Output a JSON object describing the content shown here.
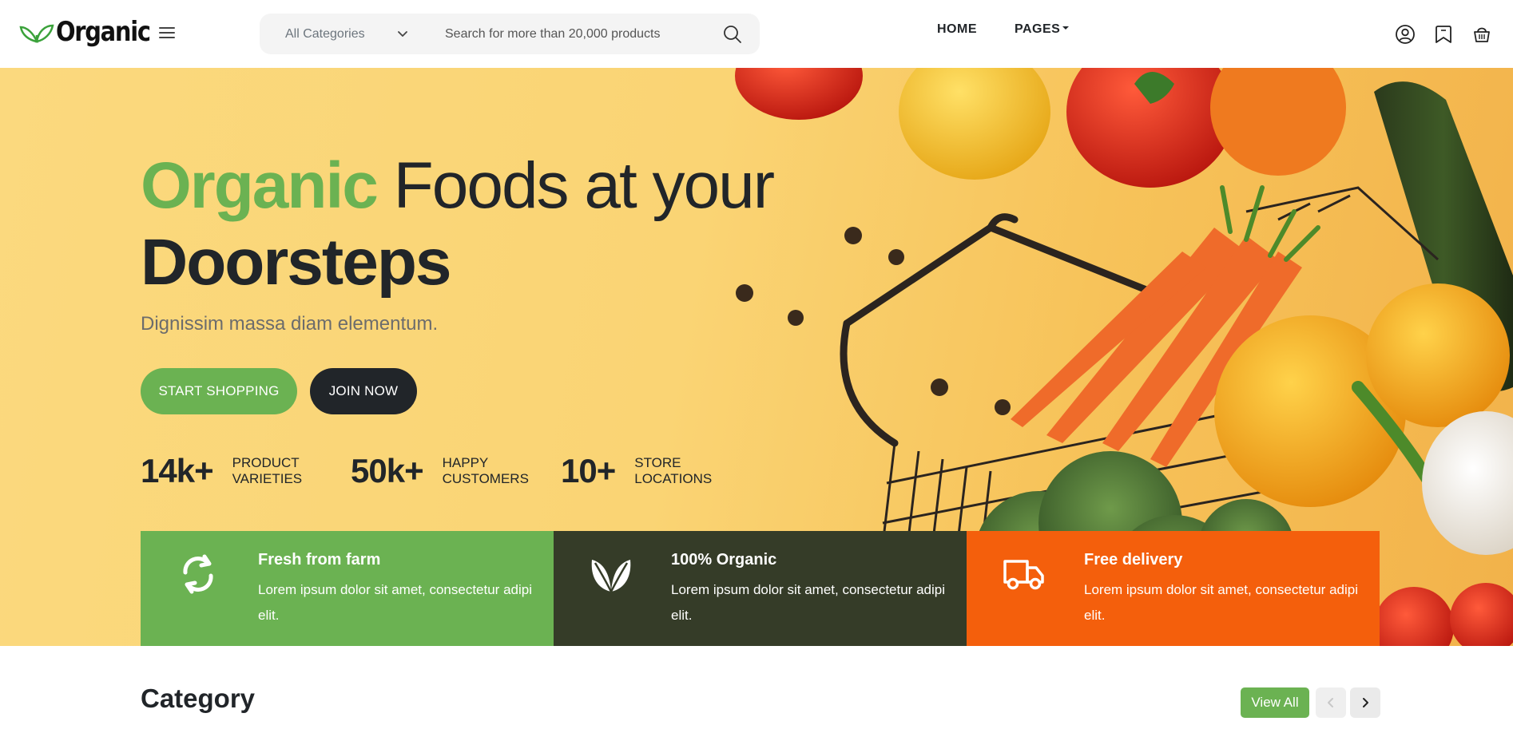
{
  "header": {
    "brand": "Organic",
    "category_select": "All Categories",
    "search_placeholder": "Search for more than 20,000 products",
    "nav": {
      "home": "HOME",
      "pages": "PAGES"
    }
  },
  "hero": {
    "title_green": "Organic",
    "title_rest": " Foods at your",
    "title_bold": "Doorsteps",
    "subtitle": "Dignissim massa diam elementum.",
    "btn_shop": "START SHOPPING",
    "btn_join": "JOIN NOW",
    "stats": [
      {
        "value": "14k+",
        "label": "PRODUCT\nVARIETIES"
      },
      {
        "value": "50k+",
        "label": "HAPPY\nCUSTOMERS"
      },
      {
        "value": "10+",
        "label": "STORE\nLOCATIONS"
      }
    ]
  },
  "features": [
    {
      "icon": "refresh-icon",
      "title": "Fresh from farm",
      "text": "Lorem ipsum dolor sit amet, consectetur adipi elit.",
      "color": "#6bb252"
    },
    {
      "icon": "leaf-icon",
      "title": "100% Organic",
      "text": "Lorem ipsum dolor sit amet, consectetur adipi elit.",
      "color": "#353c28"
    },
    {
      "icon": "truck-icon",
      "title": "Free delivery",
      "text": "Lorem ipsum dolor sit amet, consectetur adipi elit.",
      "color": "#f45f0c"
    }
  ],
  "category": {
    "title": "Category",
    "view_all": "View All"
  },
  "colors": {
    "accent_green": "#6bb252",
    "dark": "#212529",
    "orange": "#f45f0c"
  }
}
